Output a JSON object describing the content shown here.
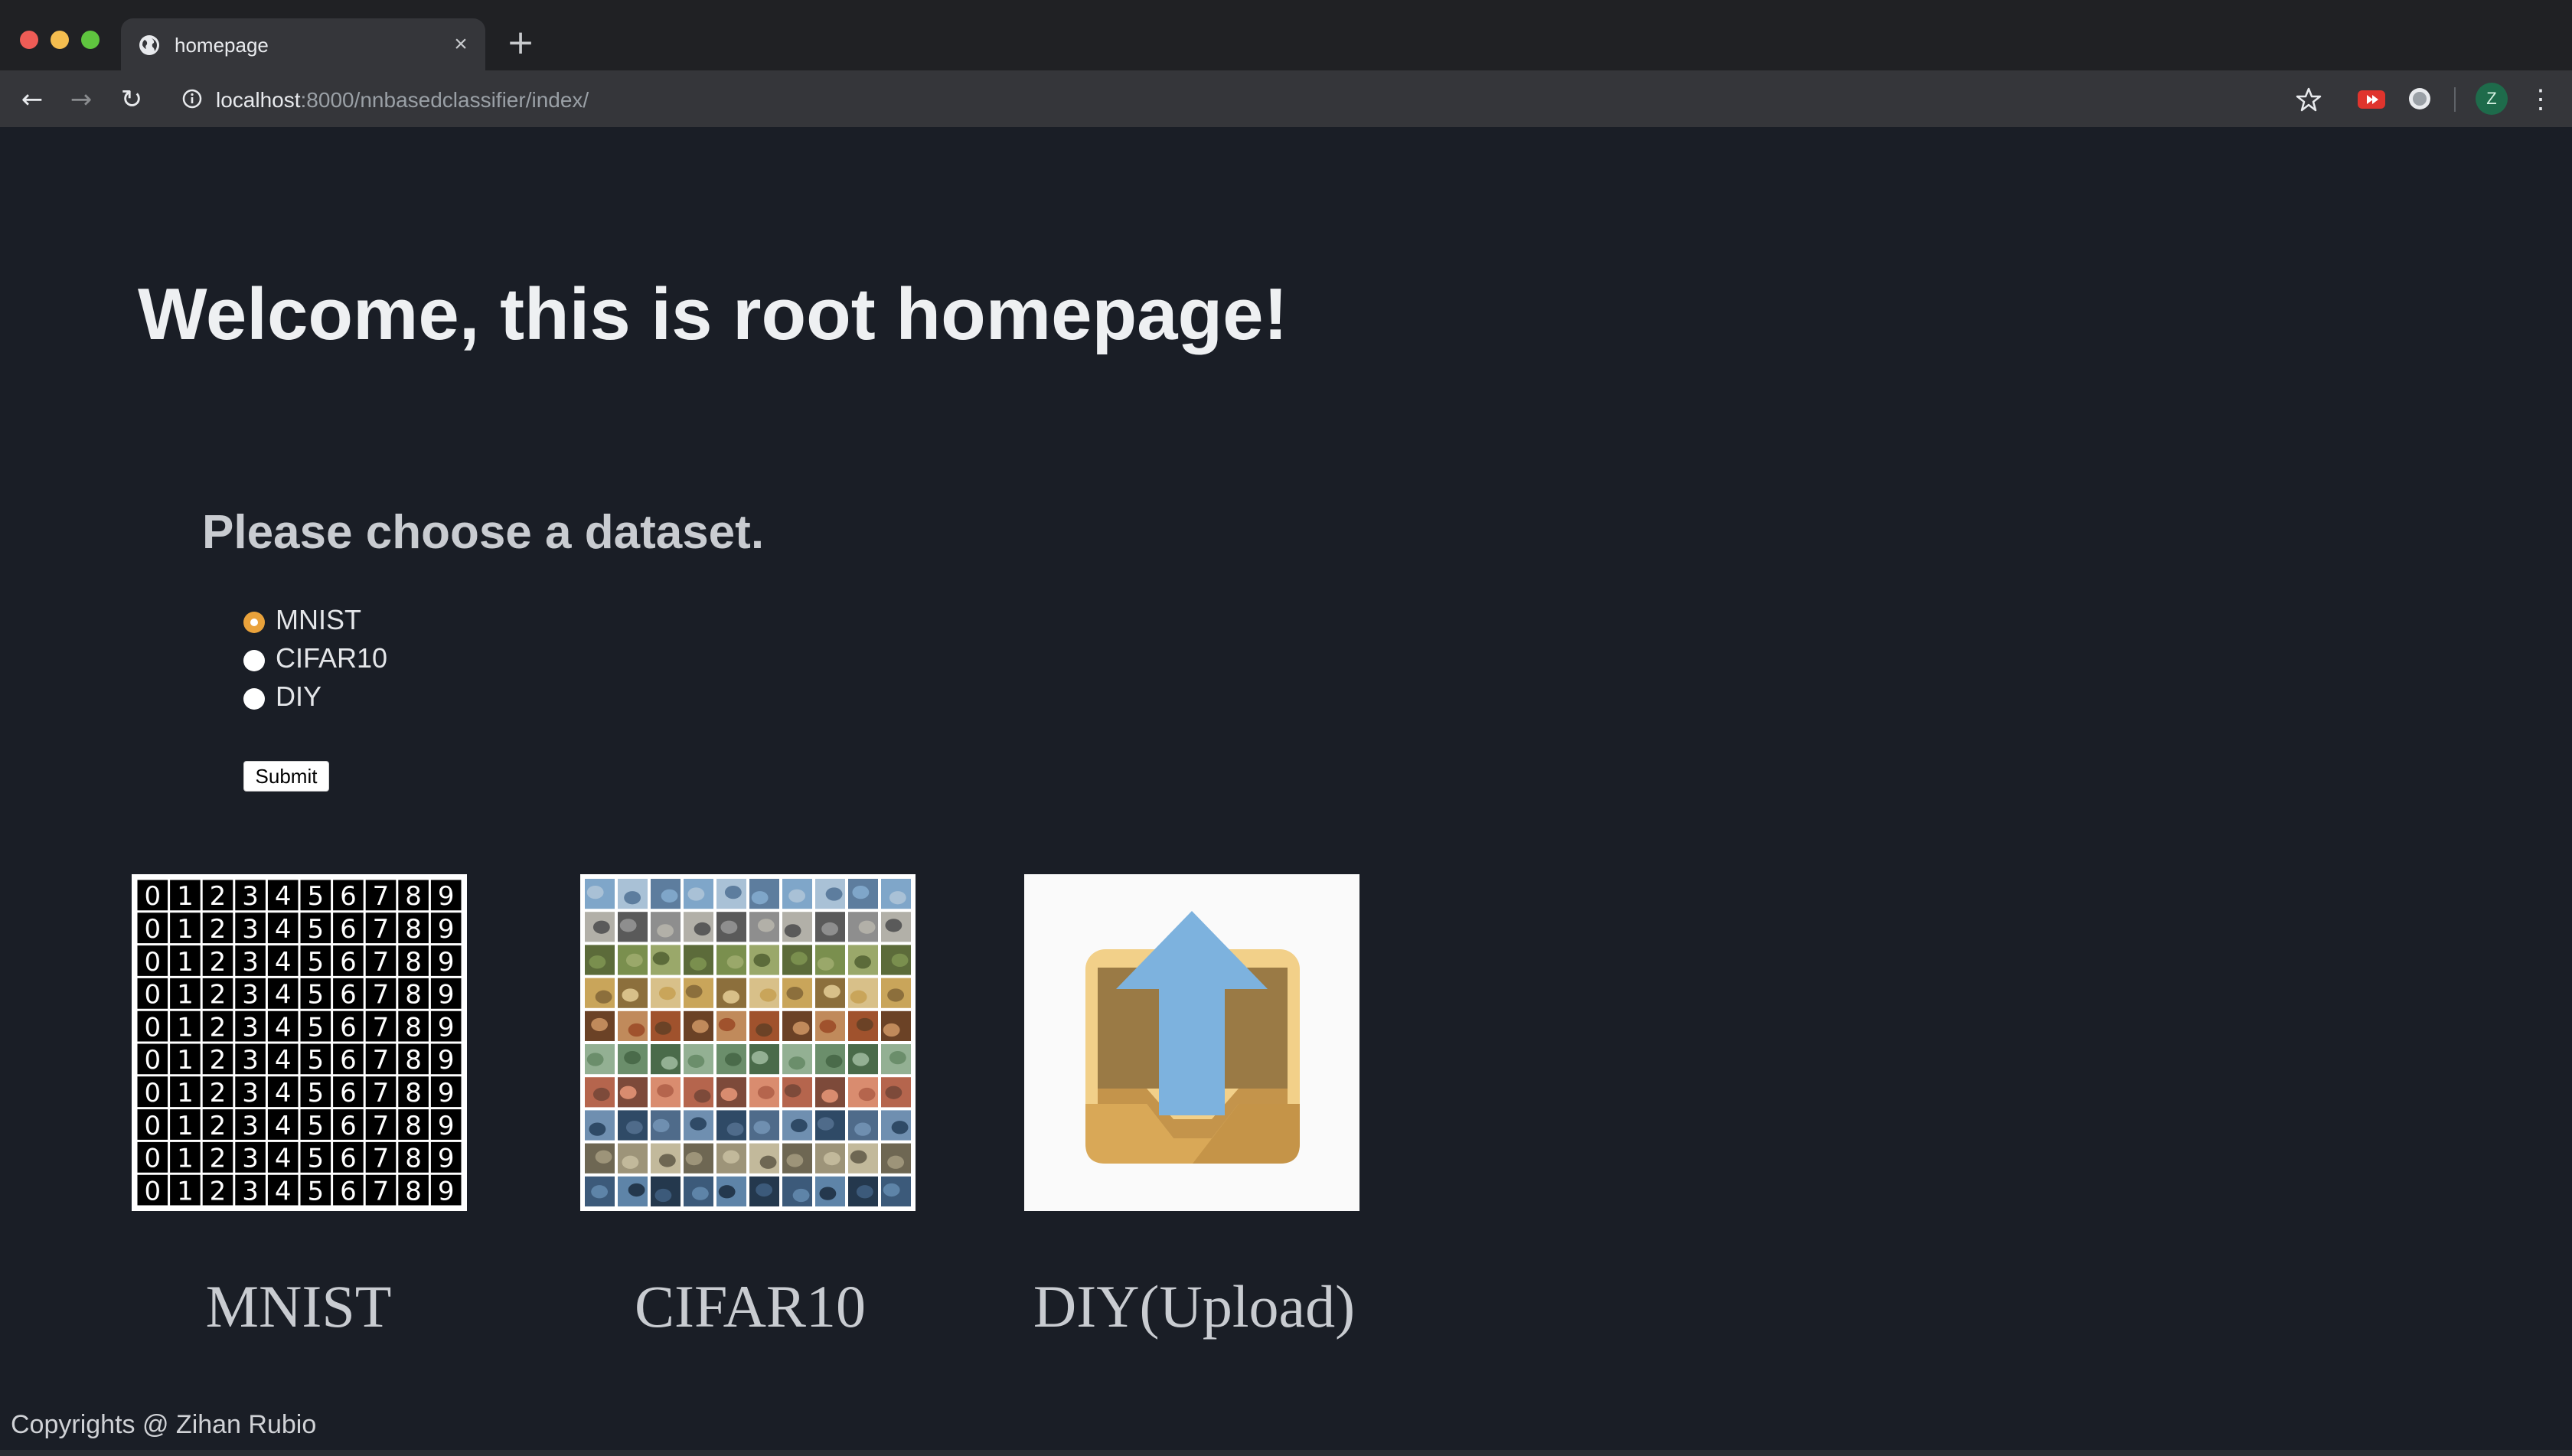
{
  "tab": {
    "title": "homepage",
    "favicon": "globe-icon",
    "close_icon": "×"
  },
  "new_tab_icon": "+",
  "nav": {
    "back_icon": "←",
    "forward_icon": "→",
    "reload_icon": "↻"
  },
  "address": {
    "host": "localhost",
    "rest": ":8000/nnbasedclassifier/index/"
  },
  "profile": {
    "initial": "Z"
  },
  "menu_icon": "⋮",
  "page": {
    "title": "Welcome, this is root homepage!",
    "subheading": "Please choose a dataset.",
    "options": [
      {
        "label": "MNIST",
        "checked": true
      },
      {
        "label": "CIFAR10",
        "checked": false
      },
      {
        "label": "DIY",
        "checked": false
      }
    ],
    "submit_label": "Submit",
    "datasets": [
      {
        "caption": "MNIST"
      },
      {
        "caption": "CIFAR10"
      },
      {
        "caption": "DIY(Upload)"
      }
    ],
    "footer": "Copyrights @ Zihan Rubio"
  },
  "colors": {
    "page_background": "#1a1e26",
    "radio_accent": "#e9a23b",
    "upload_arrow": "#7db2de",
    "upload_tray": "#d9a857"
  }
}
